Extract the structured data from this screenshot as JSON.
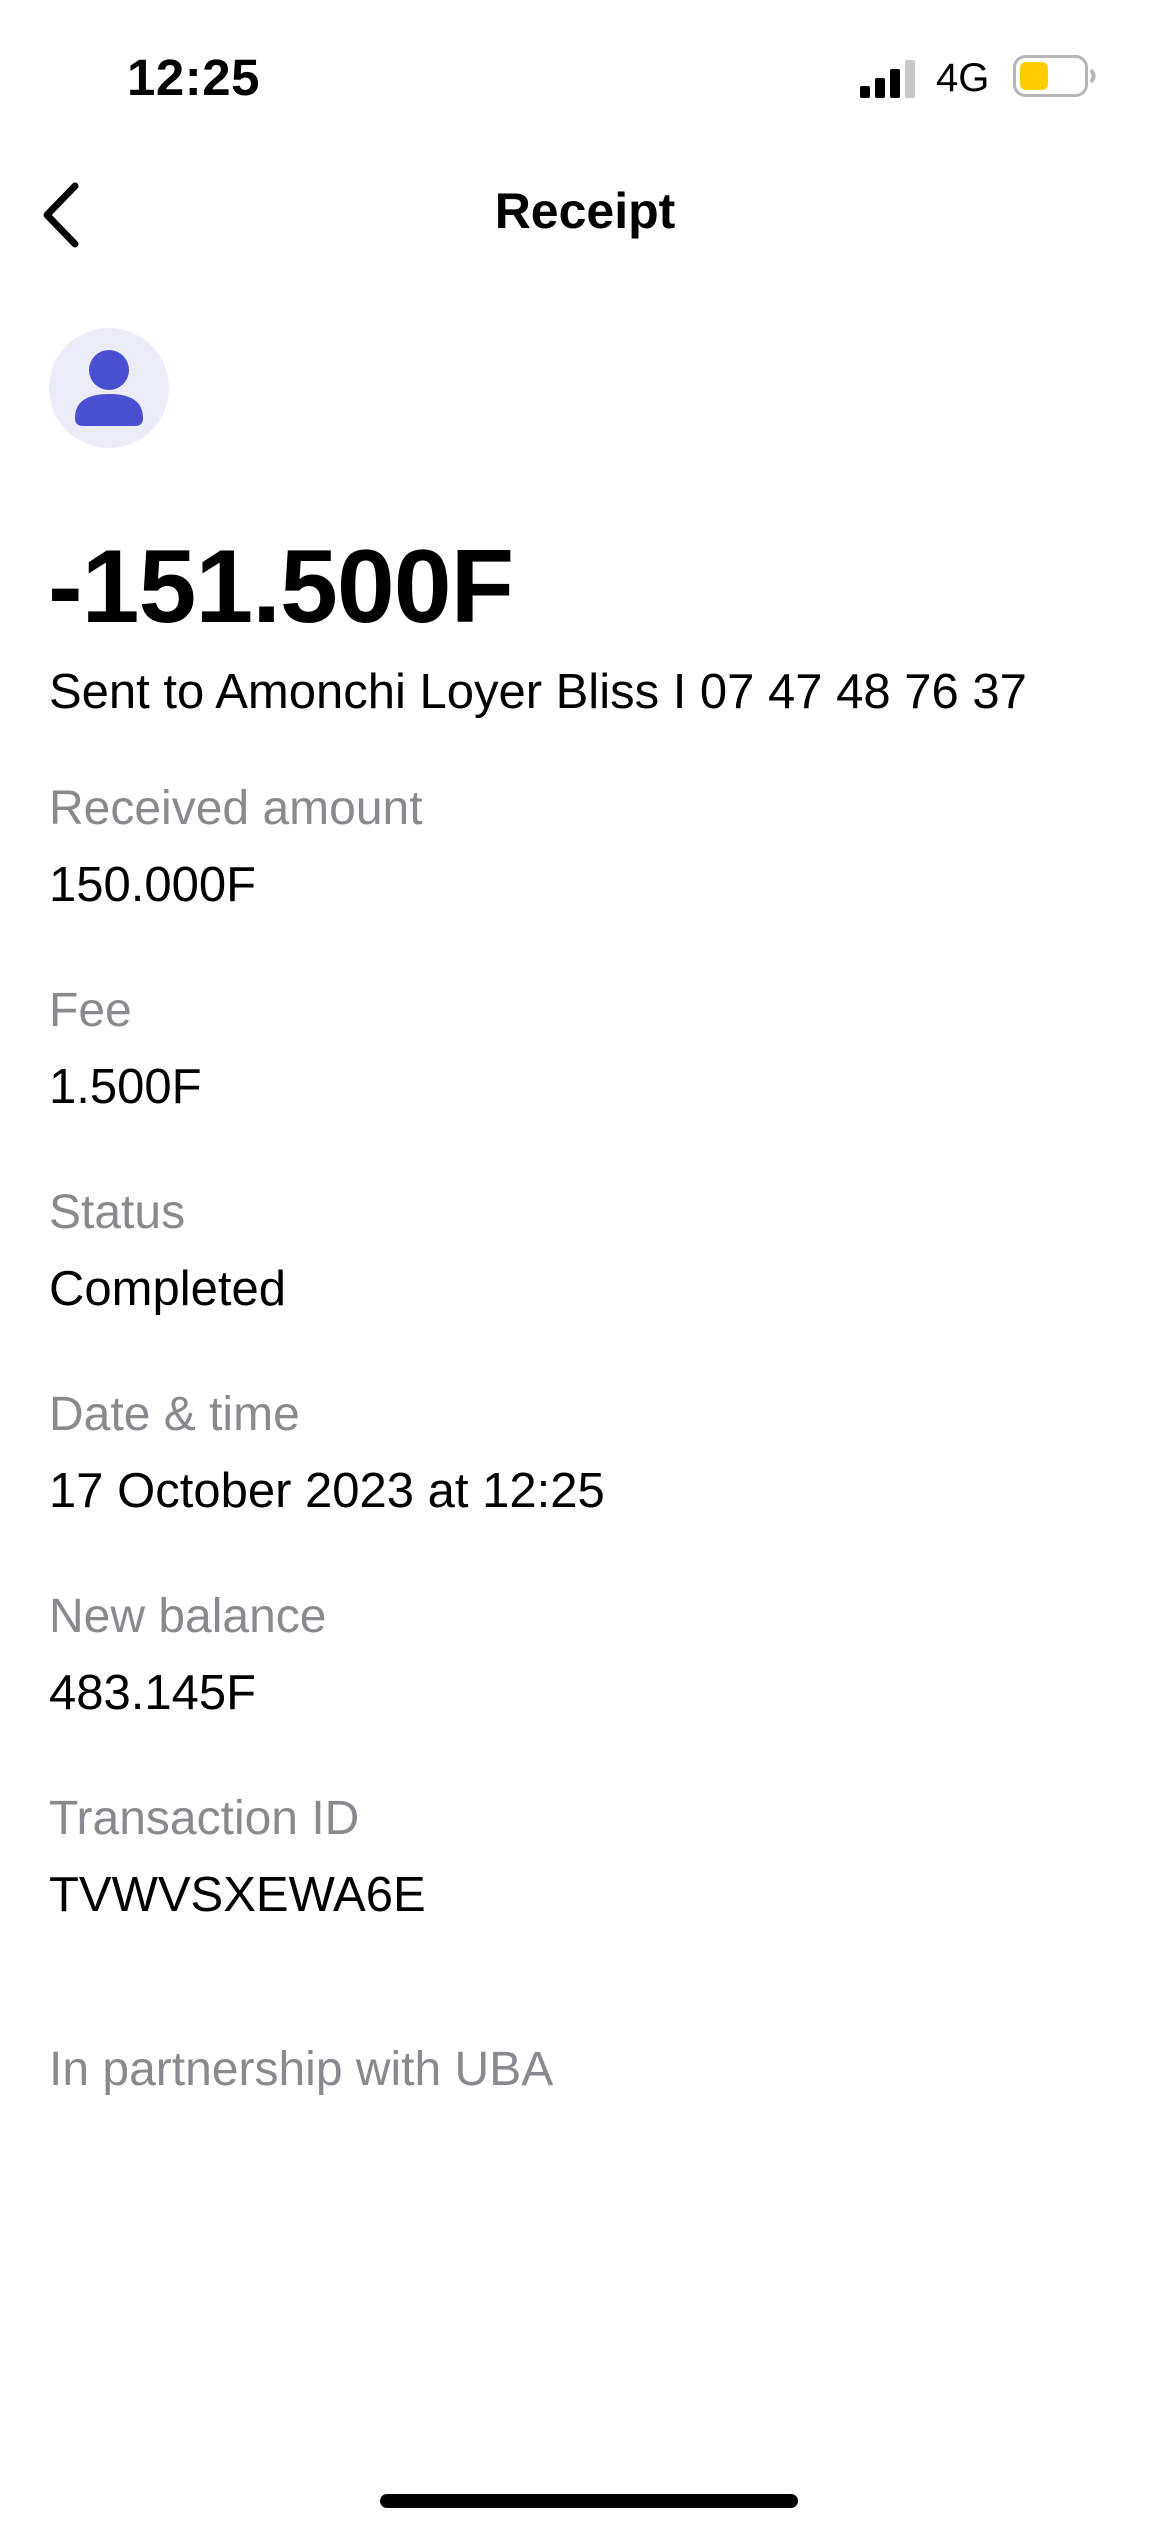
{
  "status_bar": {
    "time": "12:25",
    "network": "4G",
    "battery_color": "#ffcc00"
  },
  "nav": {
    "title": "Receipt",
    "back_icon": "chevron-left-icon"
  },
  "avatar": {
    "icon": "person-icon",
    "color": "#4a4fd1",
    "background": "#ececf8"
  },
  "transaction": {
    "amount": "-151.500F",
    "recipient": "Sent to Amonchi Loyer Bliss I 07 47 48 76 37"
  },
  "details": [
    {
      "label": "Received amount",
      "value": "150.000F"
    },
    {
      "label": "Fee",
      "value": "1.500F"
    },
    {
      "label": "Status",
      "value": "Completed"
    },
    {
      "label": "Date & time",
      "value": "17 October 2023 at 12:25"
    },
    {
      "label": "New balance",
      "value": "483.145F"
    },
    {
      "label": "Transaction ID",
      "value": "TVWVSXEWA6E"
    }
  ],
  "footer": {
    "partnership": "In partnership with UBA"
  }
}
